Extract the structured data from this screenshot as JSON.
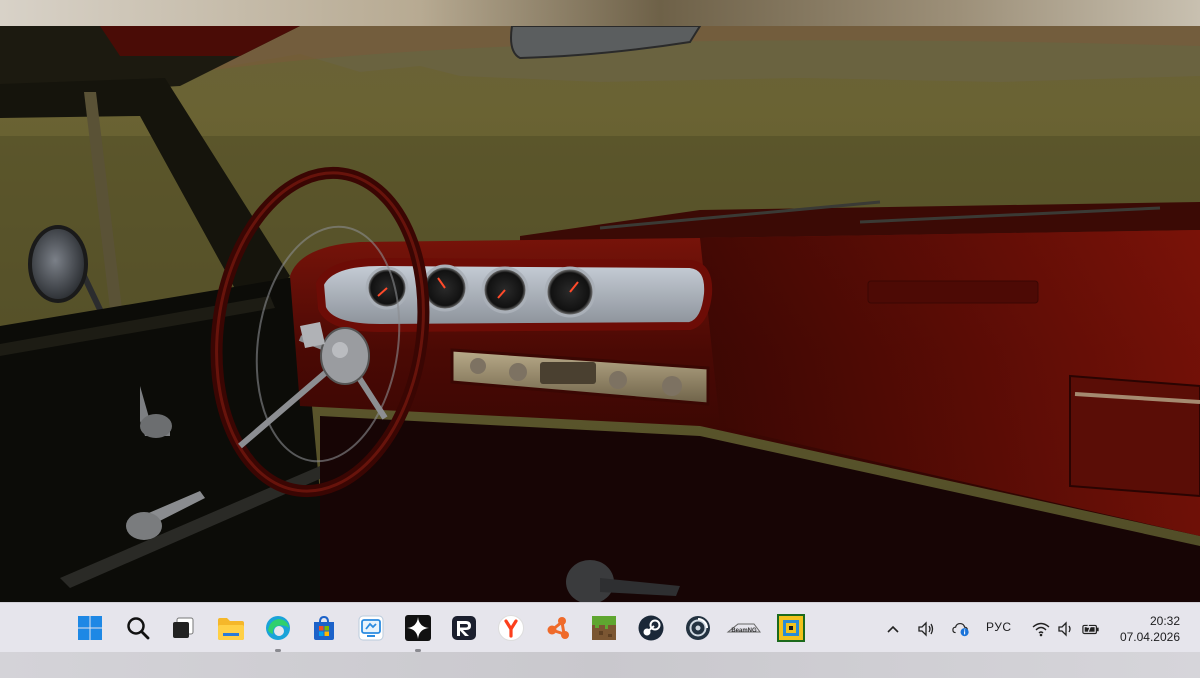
{
  "taskbar": {
    "apps": [
      {
        "id": "start",
        "icon": "windows-logo-icon"
      },
      {
        "id": "search",
        "icon": "search-icon"
      },
      {
        "id": "task-view",
        "icon": "task-view-icon"
      },
      {
        "id": "file-explorer",
        "icon": "folder-icon"
      },
      {
        "id": "edge",
        "icon": "edge-icon",
        "running": true
      },
      {
        "id": "store",
        "icon": "store-icon"
      },
      {
        "id": "app-blue",
        "icon": "remote-icon"
      },
      {
        "id": "app-star",
        "icon": "sparkle-icon",
        "running": true
      },
      {
        "id": "app-r",
        "icon": "r-letter-icon"
      },
      {
        "id": "yandex",
        "icon": "yandex-icon"
      },
      {
        "id": "app-share",
        "icon": "share-nodes-icon"
      },
      {
        "id": "minecraft",
        "icon": "grass-block-icon"
      },
      {
        "id": "steam",
        "icon": "steam-icon"
      },
      {
        "id": "app-disk",
        "icon": "disc-icon"
      },
      {
        "id": "beamng",
        "icon": "beamng-logo-icon",
        "label": "BeamNG"
      },
      {
        "id": "app-yellow",
        "icon": "yellow-game-icon"
      }
    ],
    "tray": {
      "chevron_icon": "chevron-up-icon",
      "volume_icon": "speaker-icon",
      "cloud_icon": "cloud-info-icon",
      "language": "РУС",
      "wifi_icon": "wifi-icon",
      "volume2_icon": "speaker-icon",
      "battery_icon": "battery-charging-icon"
    },
    "clock": {
      "time": "20:32",
      "date": "07.04.2026"
    }
  },
  "colors": {
    "taskbar_bg": "#e6e5ec",
    "sky": "#5a5530",
    "dashboard_red": "#6b0d06"
  }
}
